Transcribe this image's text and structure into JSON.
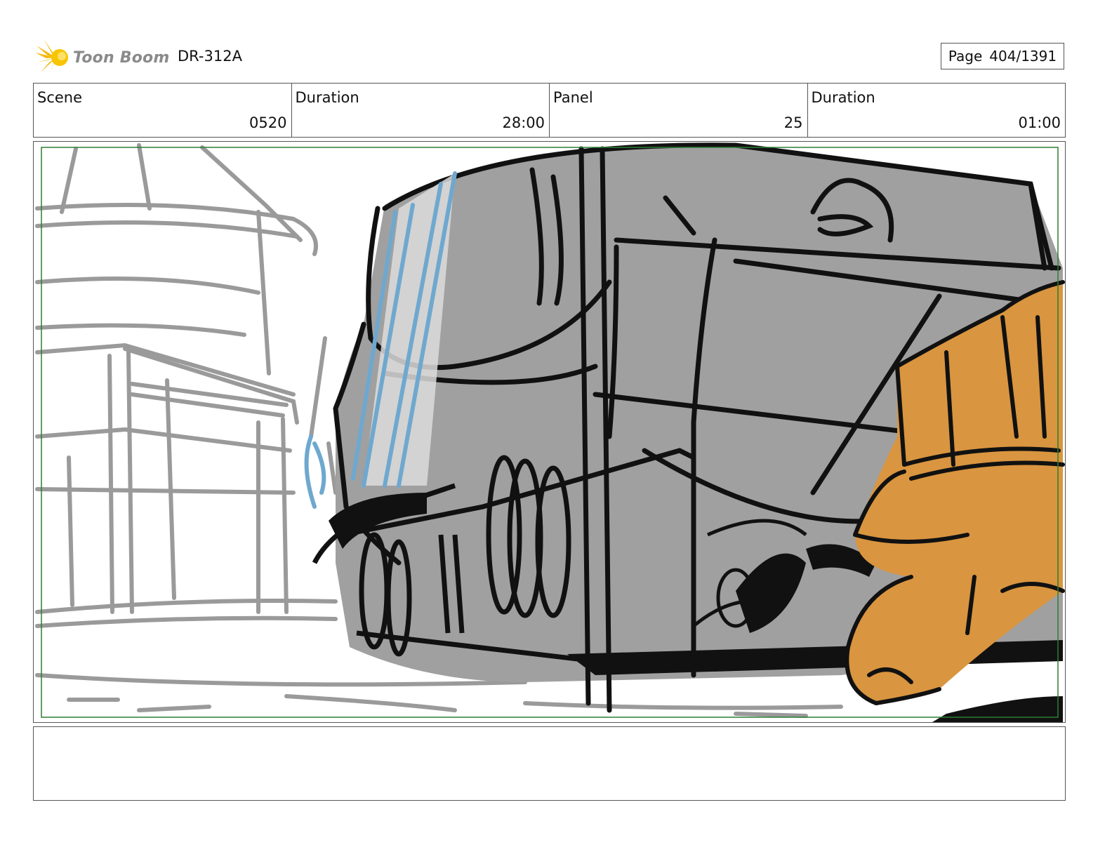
{
  "header": {
    "logo_text": "Toon Boom",
    "production_code": "DR-312A",
    "page_label": "Page",
    "page_value": "404/1391"
  },
  "info": {
    "scene_label": "Scene",
    "scene_value": "0520",
    "scene_duration_label": "Duration",
    "scene_duration_value": "28:00",
    "panel_label": "Panel",
    "panel_value": "25",
    "panel_duration_label": "Duration",
    "panel_duration_value": "01:00"
  },
  "colors": {
    "safe_frame": "#2e7d32",
    "train_fill": "#a0a0a0",
    "hand_fill": "#d9953f",
    "highlight": "#6fa8cf",
    "sketch_gray": "#9a9a9a"
  },
  "notes": {
    "text": ""
  }
}
